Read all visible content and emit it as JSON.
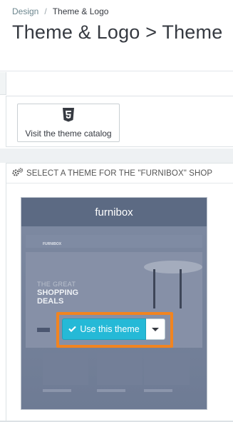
{
  "breadcrumb": {
    "parent": "Design",
    "separator": "/",
    "current": "Theme & Logo"
  },
  "page_title": "Theme & Logo > Theme",
  "catalog": {
    "button_label": "Visit the theme catalog",
    "icon": "html5-icon"
  },
  "theme_panel": {
    "heading_icon": "cogs-icon",
    "heading": "SELECT A THEME FOR THE \"FURNIBOX\" SHOP",
    "theme_name": "furnibox",
    "preview": {
      "logo": "FURNIBOX",
      "tagline": "THE GREAT",
      "headline_1": "SHOPPING",
      "headline_2": "DEALS"
    },
    "use_button_label": "Use this theme",
    "use_button_icon": "check-icon",
    "dropdown_icon": "caret-down-icon"
  },
  "colors": {
    "accent": "#25b9d7",
    "highlight": "#f18420",
    "card_header": "#5c6a83"
  }
}
